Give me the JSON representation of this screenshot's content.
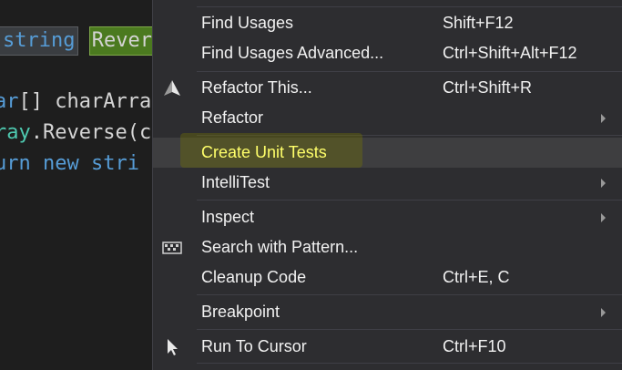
{
  "editor": {
    "lines": [
      {
        "parts": [
          {
            "t": "string",
            "c": "kw"
          },
          {
            "t": " ",
            "c": "tx"
          },
          {
            "t": "Rever",
            "c": "hl"
          }
        ]
      },
      {
        "parts": [
          {
            "t": "ar",
            "c": "kw"
          },
          {
            "t": "[] charArra",
            "c": "tx"
          }
        ]
      },
      {
        "parts": [
          {
            "t": "ray",
            "c": "ty"
          },
          {
            "t": ".Reverse(c",
            "c": "tx"
          }
        ]
      },
      {
        "parts": [
          {
            "t": "urn new stri",
            "c": "kw"
          }
        ]
      }
    ]
  },
  "menu": {
    "find_usages": {
      "label": "Find Usages",
      "shortcut": "Shift+F12"
    },
    "find_usages_adv": {
      "label": "Find Usages Advanced...",
      "shortcut": "Ctrl+Shift+Alt+F12"
    },
    "refactor_this": {
      "label": "Refactor This...",
      "shortcut": "Ctrl+Shift+R",
      "icon": "refactor-icon"
    },
    "refactor": {
      "label": "Refactor"
    },
    "create_unit_tests": {
      "label": "Create Unit Tests"
    },
    "intellitest": {
      "label": "IntelliTest"
    },
    "inspect": {
      "label": "Inspect"
    },
    "search_pattern": {
      "label": "Search with Pattern...",
      "icon": "pattern-icon"
    },
    "cleanup_code": {
      "label": "Cleanup Code",
      "shortcut": "Ctrl+E, C"
    },
    "breakpoint": {
      "label": "Breakpoint"
    },
    "run_to_cursor": {
      "label": "Run To Cursor",
      "shortcut": "Ctrl+F10",
      "icon": "cursor-icon"
    }
  },
  "colors": {
    "menu_bg": "#2d2d30",
    "highlight_text": "#ffff6a",
    "editor_bg": "#1e1e1e",
    "keyword": "#569cd6"
  }
}
